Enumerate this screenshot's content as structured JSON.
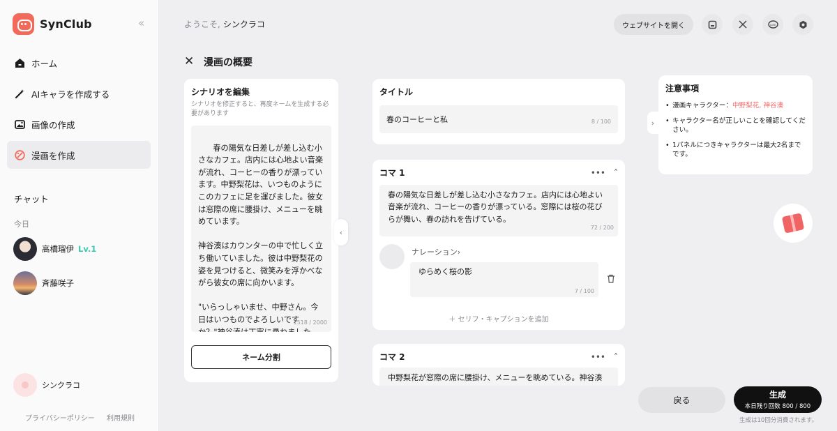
{
  "app": {
    "name": "SynClub"
  },
  "sidebar": {
    "collapse_label": "«",
    "nav": [
      {
        "label": "ホーム",
        "icon": "home-icon"
      },
      {
        "label": "AIキャラを作成する",
        "icon": "magic-wand-icon"
      },
      {
        "label": "画像の作成",
        "icon": "image-icon"
      },
      {
        "label": "漫画を作成",
        "icon": "palette-icon"
      }
    ],
    "chat_header": "チャット",
    "today_label": "今日",
    "chats": [
      {
        "name": "高橋瑠伊",
        "level": "Lv.1"
      },
      {
        "name": "斉藤咲子"
      }
    ],
    "user_name": "シンクラコ",
    "footer_links": [
      "プライバシーポリシー",
      "利用規則"
    ]
  },
  "header": {
    "welcome_prefix": "ようこそ,",
    "user_name": "シンクラコ",
    "website_button": "ウェブサイトを開く",
    "icons": [
      "discord-icon",
      "x-icon",
      "line-icon",
      "settings-icon"
    ]
  },
  "page": {
    "title": "漫画の概要"
  },
  "scenario": {
    "title": "シナリオを編集",
    "hint": "シナリオを修正すると、再度ネームを生成する必要があります",
    "text": "春の陽気な日差しが差し込む小さなカフェ。店内には心地よい音楽が流れ、コーヒーの香りが漂っています。中野梨花は、いつものようにこのカフェに足を運びました。彼女は窓際の席に腰掛け、メニューを眺めています。\n\n神谷湊はカウンターの中で忙しく立ち働いていました。彼は中野梨花の姿を見つけると、微笑みを浮かべながら彼女の席に向かいます。\n\n\"いらっしゃいませ、中野さん。今日はいつものでよろしいですか？\"神谷湊は丁寧に尋ねました。",
    "counter": "1518 / 2000",
    "split_button": "ネーム分割"
  },
  "title_card": {
    "label": "タイトル",
    "value": "春のコーヒーと私",
    "counter": "8 / 100"
  },
  "panels": [
    {
      "label": "コマ 1",
      "text": "春の陽気な日差しが差し込む小さなカフェ。店内には心地よい音楽が流れ、コーヒーの香りが漂っている。窓際には桜の花びらが舞い、春の訪れを告げている。",
      "counter": "72 / 200",
      "narration_label": "ナレーション›",
      "narration_text": "ゆらめく桜の影",
      "narration_counter": "7 / 100",
      "add_label": "＋ セリフ・キャプションを追加"
    },
    {
      "label": "コマ 2",
      "text": "中野梨花が窓際の席に腰掛け、メニューを眺めている。神谷湊"
    }
  ],
  "notes": {
    "title": "注意事項",
    "items": [
      {
        "prefix": "漫画キャラクター：",
        "highlight": "中野梨花, 神谷湊"
      },
      {
        "prefix": "キャラクター名が正しいことを確認してください。"
      },
      {
        "prefix": "1パネルにつきキャラクターは最大2名までです。"
      }
    ]
  },
  "actions": {
    "back": "戻る",
    "generate": "生成",
    "remaining": "本日残り回数 800 / 800",
    "note": "生成は10回分消費されます。"
  },
  "colors": {
    "accent": "#f26a5a",
    "highlight": "#ef6a6a",
    "level": "#3cc9b0"
  }
}
